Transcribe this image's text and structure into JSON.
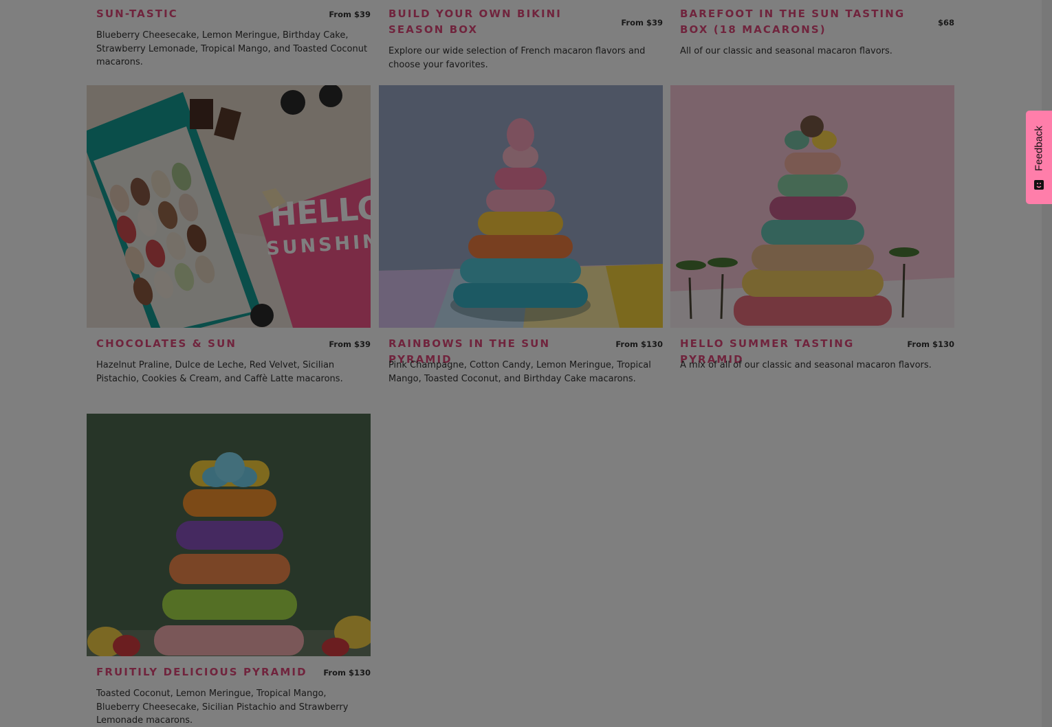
{
  "products": [
    {
      "title": "Sun-Tastic",
      "price": "From $39",
      "description": "Blueberry Cheesecake, Lemon Meringue, Birthday Cake, Strawberry Lemonade, Tropical Mango, and Toasted Coconut macarons."
    },
    {
      "title": "Build Your Own Bikini Season Box",
      "price": "From $39",
      "description": "Explore our wide selection of French macaron flavors and choose your favorites."
    },
    {
      "title": "Barefoot in the Sun Tasting Box (18 Macarons)",
      "price": "$68",
      "description": "All of our classic and seasonal macaron flavors."
    },
    {
      "title": "Chocolates & Sun",
      "price": "From $39",
      "description": "Hazelnut Praline, Dulce de Leche, Red Velvet, Sicilian Pistachio, Cookies & Cream, and Caffè Latte macarons.",
      "image_text": [
        "HELLO",
        "SUNSHINE"
      ]
    },
    {
      "title": "Rainbows in the Sun Pyramid",
      "price": "From $130",
      "description": "Pink Champagne, Cotton Candy, Lemon Meringue, Tropical Mango, Toasted Coconut, and Birthday Cake macarons."
    },
    {
      "title": "Hello Summer Tasting Pyramid",
      "price": "From $130",
      "description": "A mix of all of our classic and seasonal macaron flavors."
    },
    {
      "title": "Fruitily Delicious Pyramid",
      "price": "From $130",
      "description": "Toasted Coconut, Lemon Meringue, Tropical Mango, Blueberry Cheesecake, Sicilian Pistachio and Strawberry Lemonade macarons."
    }
  ],
  "feedback_tab": {
    "label": "Feedback",
    "icon": "smiley-icon"
  },
  "colors": {
    "title": "#e0487a",
    "text": "#333333",
    "overlay": "rgba(0,0,0,0.5)",
    "feedback_tab": "#ff7eaa"
  }
}
